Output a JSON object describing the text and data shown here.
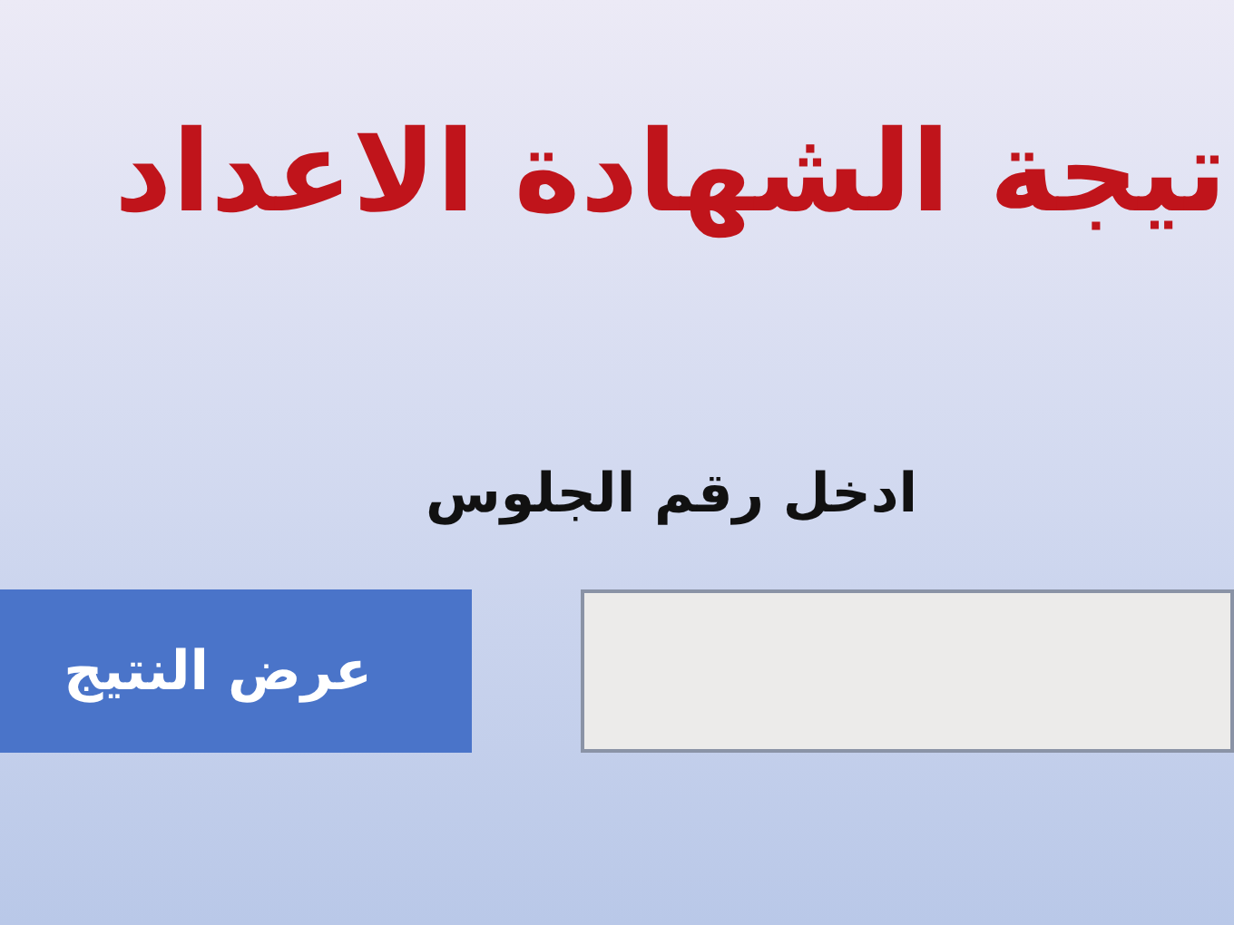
{
  "title": "تيجة الشهادة الاعداد",
  "seat_number_label": "ادخل رقم الجلوس",
  "show_result_button": "عرض النتيج"
}
